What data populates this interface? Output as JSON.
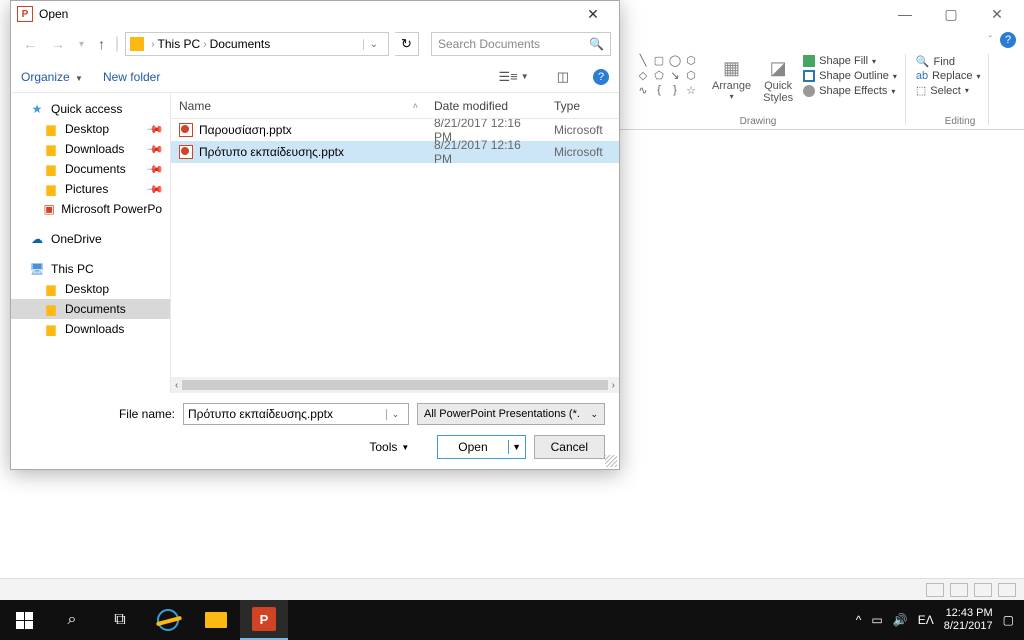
{
  "app": {
    "window_controls": {
      "min": "—",
      "max": "▢",
      "close": "✕"
    }
  },
  "ribbon": {
    "arrange": "Arrange",
    "quick_styles": "Quick\nStyles",
    "shape_fill": "Shape Fill",
    "shape_outline": "Shape Outline",
    "shape_effects": "Shape Effects",
    "find": "Find",
    "replace": "Replace",
    "select": "Select",
    "group_drawing": "Drawing",
    "group_editing": "Editing"
  },
  "dialog": {
    "title": "Open",
    "breadcrumb": {
      "root": "This PC",
      "folder": "Documents"
    },
    "search_placeholder": "Search Documents",
    "organize": "Organize",
    "new_folder": "New folder",
    "columns": {
      "name": "Name",
      "date": "Date modified",
      "type": "Type"
    },
    "files": [
      {
        "name": "Παρουσίαση.pptx",
        "date": "8/21/2017 12:16 PM",
        "type": "Microsoft",
        "selected": false
      },
      {
        "name": "Πρότυπο εκπαίδευσης.pptx",
        "date": "8/21/2017 12:16 PM",
        "type": "Microsoft",
        "selected": true
      }
    ],
    "tree": {
      "quick_access": "Quick access",
      "desktop": "Desktop",
      "downloads": "Downloads",
      "documents": "Documents",
      "pictures": "Pictures",
      "mspp": "Microsoft PowerPo",
      "onedrive": "OneDrive",
      "this_pc": "This PC",
      "desktop2": "Desktop",
      "documents2": "Documents",
      "downloads2": "Downloads"
    },
    "filename_label": "File name:",
    "filename_value": "Πρότυπο εκπαίδευσης.pptx",
    "filter": "All PowerPoint Presentations (*.",
    "tools": "Tools",
    "open": "Open",
    "cancel": "Cancel"
  },
  "taskbar": {
    "lang": "ΕΛ",
    "time": "12:43 PM",
    "date": "8/21/2017"
  }
}
